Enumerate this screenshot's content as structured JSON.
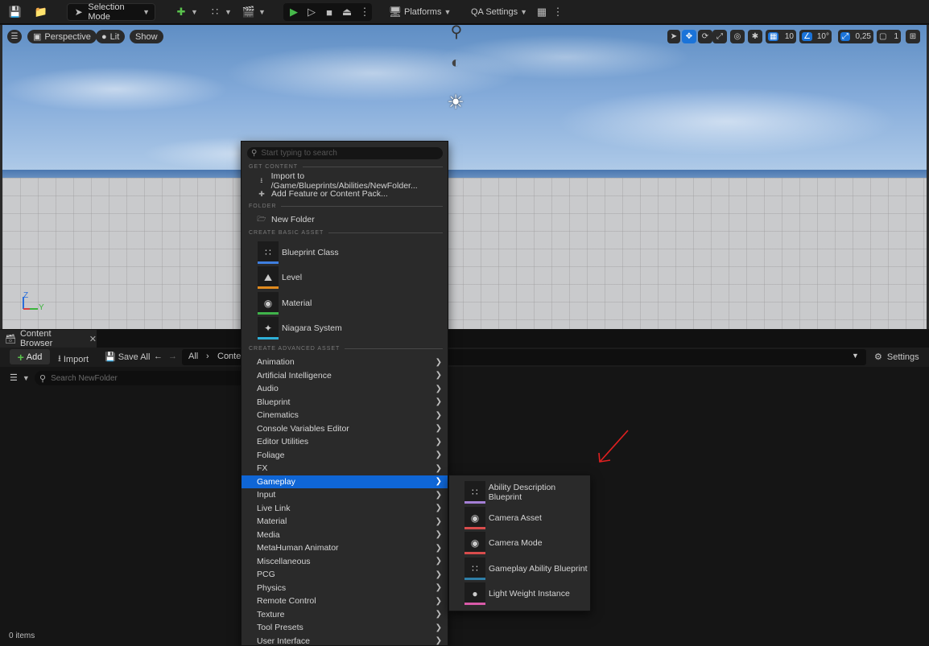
{
  "toolbar": {
    "mode_label": "Selection Mode",
    "platforms_label": "Platforms",
    "qa_settings_label": "QA Settings"
  },
  "viewport": {
    "perspective_label": "Perspective",
    "lit_label": "Lit",
    "show_label": "Show",
    "grid_snap_value": "10",
    "rotation_snap_value": "10°",
    "scale_snap_value": "0,25",
    "camera_speed_value": "1",
    "gizmo_z": "Z",
    "gizmo_y": "Y"
  },
  "content_browser": {
    "tab_label": "Content Browser",
    "add_label": "Add",
    "import_label": "Import",
    "save_all_label": "Save All",
    "path_root": "All",
    "path_segment": "Conten",
    "settings_label": "Settings",
    "search_placeholder": "Search NewFolder",
    "items_count": "0 items"
  },
  "context_menu": {
    "search_placeholder": "Start typing to search",
    "sections": {
      "get_content": "GET CONTENT",
      "folder": "FOLDER",
      "create_basic": "CREATE BASIC ASSET",
      "create_advanced": "CREATE ADVANCED ASSET"
    },
    "get_content_items": [
      "Import to /Game/Blueprints/Abilities/NewFolder...",
      "Add Feature or Content Pack..."
    ],
    "folder_items": [
      "New Folder"
    ],
    "basic_assets": [
      {
        "label": "Blueprint Class",
        "color": "#3f7fe0"
      },
      {
        "label": "Level",
        "color": "#e08a1e"
      },
      {
        "label": "Material",
        "color": "#3fb34a"
      },
      {
        "label": "Niagara System",
        "color": "#2fb0d8"
      }
    ],
    "advanced_categories": [
      "Animation",
      "Artificial Intelligence",
      "Audio",
      "Blueprint",
      "Cinematics",
      "Console Variables Editor",
      "Editor Utilities",
      "Foliage",
      "FX",
      "Gameplay",
      "Input",
      "Live Link",
      "Material",
      "Media",
      "MetaHuman Animator",
      "Miscellaneous",
      "PCG",
      "Physics",
      "Remote Control",
      "Texture",
      "Tool Presets",
      "User Interface"
    ],
    "active_category": "Gameplay"
  },
  "gameplay_submenu": [
    {
      "label": "Ability Description Blueprint",
      "color": "#a57fd6"
    },
    {
      "label": "Camera Asset",
      "color": "#d84c4c"
    },
    {
      "label": "Camera Mode",
      "color": "#d84c4c"
    },
    {
      "label": "Gameplay Ability Blueprint",
      "color": "#2f7fa8"
    },
    {
      "label": "Light Weight Instance",
      "color": "#d85aa8"
    }
  ],
  "colors": {
    "accent": "#0f66d6",
    "play_green": "#46b84a",
    "annotation_red": "#e02020"
  }
}
